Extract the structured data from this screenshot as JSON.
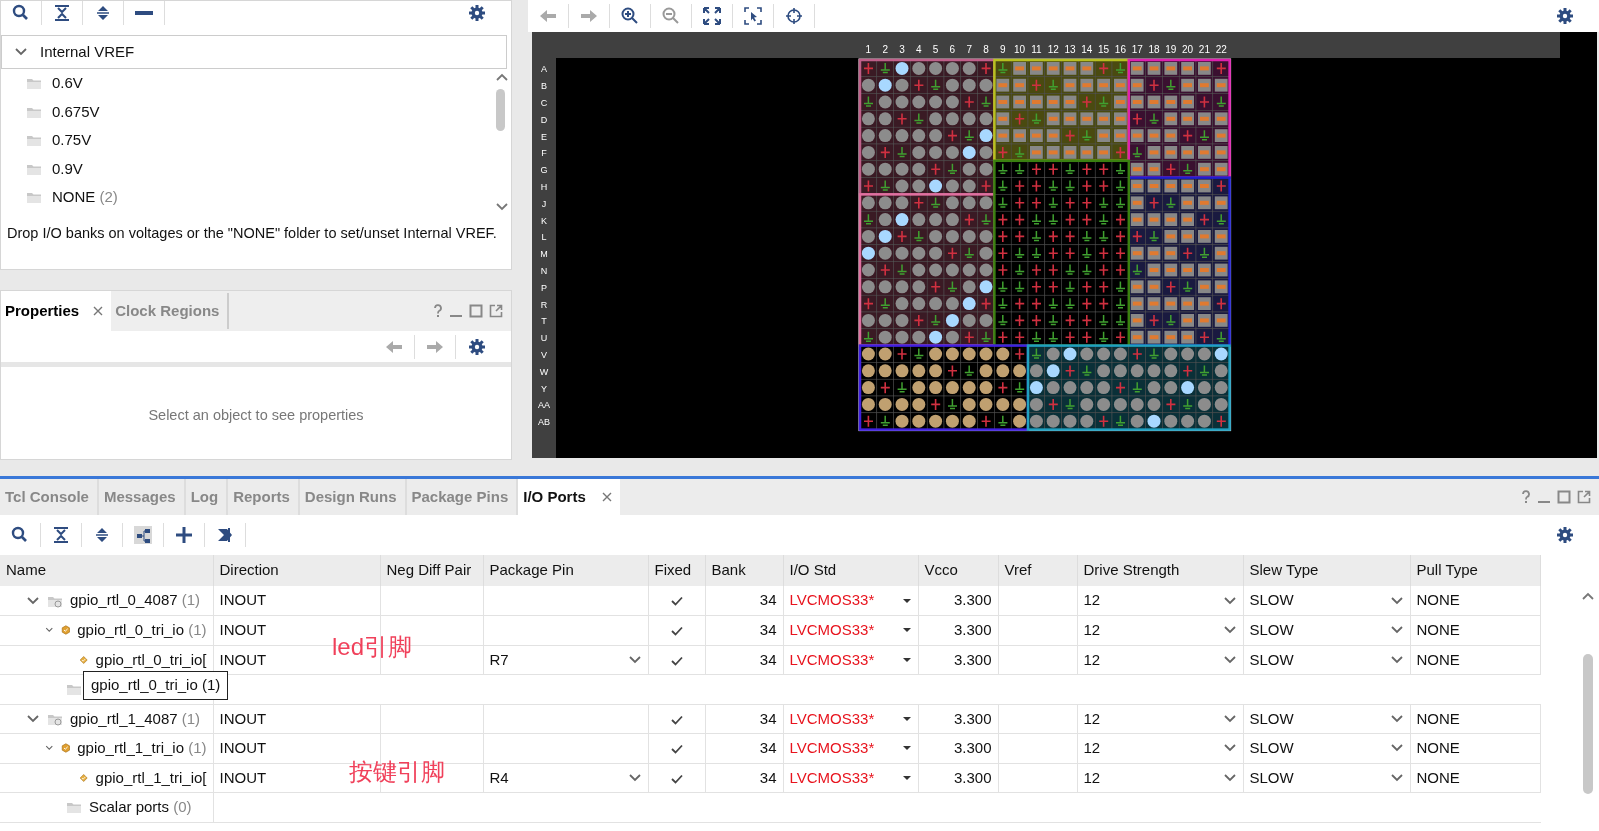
{
  "vref_panel": {
    "header": "Internal VREF",
    "expanded": true,
    "items": [
      {
        "label": "0.6V"
      },
      {
        "label": "0.675V"
      },
      {
        "label": "0.75V"
      },
      {
        "label": "0.9V"
      },
      {
        "label": "NONE",
        "count": "(2)"
      }
    ],
    "hint": "Drop I/O banks on voltages or the \"NONE\" folder to set/unset Internal VREF."
  },
  "properties_panel": {
    "tabs": [
      {
        "label": "Properties",
        "selected": true,
        "closable": true
      },
      {
        "label": "Clock Regions",
        "selected": false,
        "closable": false
      }
    ],
    "empty_message": "Select an object to see properties"
  },
  "package_view": {
    "column_labels": [
      "1",
      "2",
      "3",
      "4",
      "5",
      "6",
      "7",
      "8",
      "9",
      "10",
      "11",
      "12",
      "13",
      "14",
      "15",
      "16",
      "17",
      "18",
      "19",
      "20",
      "21",
      "22"
    ],
    "row_labels": [
      "A",
      "B",
      "C",
      "D",
      "E",
      "F",
      "G",
      "H",
      "J",
      "K",
      "L",
      "M",
      "N",
      "P",
      "R",
      "T",
      "U",
      "V",
      "W",
      "Y",
      "AA",
      "AB"
    ]
  },
  "io_ports_panel": {
    "tabs": [
      {
        "label": "Tcl Console",
        "selected": false,
        "closable": false
      },
      {
        "label": "Messages",
        "selected": false,
        "closable": false
      },
      {
        "label": "Log",
        "selected": false,
        "closable": false
      },
      {
        "label": "Reports",
        "selected": false,
        "closable": false
      },
      {
        "label": "Design Runs",
        "selected": false,
        "closable": false
      },
      {
        "label": "Package Pins",
        "selected": false,
        "closable": false
      },
      {
        "label": "I/O Ports",
        "selected": true,
        "closable": true
      }
    ],
    "columns": [
      "Name",
      "Direction",
      "Neg Diff Pair",
      "Package Pin",
      "Fixed",
      "Bank",
      "I/O Std",
      "Vcco",
      "Vref",
      "Drive Strength",
      "Slew Type",
      "Pull Type"
    ],
    "rows": [
      {
        "kind": "group",
        "name": "gpio_rtl_0_4087",
        "count": "(1)",
        "expanded": true,
        "direction": "INOUT",
        "fixed": true,
        "bank": "34",
        "io_std": "LVCMOS33*",
        "vcco": "3.300",
        "drive_strength": "12",
        "slew_type": "SLOW",
        "pull_type": "NONE",
        "children": [
          {
            "kind": "bus",
            "name": "gpio_rtl_0_tri_io",
            "count": "(1)",
            "expanded": true,
            "direction": "INOUT",
            "fixed": true,
            "bank": "34",
            "io_std": "LVCMOS33*",
            "vcco": "3.300",
            "drive_strength": "12",
            "slew_type": "SLOW",
            "pull_type": "NONE",
            "children": [
              {
                "kind": "port",
                "name": "gpio_rtl_0_tri_io[",
                "direction": "INOUT",
                "package_pin": "R7",
                "fixed": true,
                "bank": "34",
                "io_std": "LVCMOS33*",
                "vcco": "3.300",
                "drive_strength": "12",
                "slew_type": "SLOW",
                "pull_type": "NONE"
              }
            ]
          },
          {
            "kind": "covered"
          }
        ]
      },
      {
        "kind": "group",
        "name": "gpio_rtl_1_4087",
        "count": "(1)",
        "expanded": true,
        "direction": "INOUT",
        "fixed": true,
        "bank": "34",
        "io_std": "LVCMOS33*",
        "vcco": "3.300",
        "drive_strength": "12",
        "slew_type": "SLOW",
        "pull_type": "NONE",
        "children": [
          {
            "kind": "bus",
            "name": "gpio_rtl_1_tri_io",
            "count": "(1)",
            "expanded": true,
            "direction": "INOUT",
            "fixed": true,
            "bank": "34",
            "io_std": "LVCMOS33*",
            "vcco": "3.300",
            "drive_strength": "12",
            "slew_type": "SLOW",
            "pull_type": "NONE",
            "children": [
              {
                "kind": "port",
                "name": "gpio_rtl_1_tri_io[",
                "direction": "INOUT",
                "package_pin": "R4",
                "fixed": true,
                "bank": "34",
                "io_std": "LVCMOS33*",
                "vcco": "3.300",
                "drive_strength": "12",
                "slew_type": "SLOW",
                "pull_type": "NONE"
              }
            ]
          },
          {
            "kind": "folder",
            "name": "Scalar ports",
            "count": "(0)"
          }
        ]
      }
    ],
    "tooltip": "gpio_rtl_0_tri_io (1)",
    "annotations": [
      {
        "text": "led引脚"
      },
      {
        "text": "按键引脚"
      }
    ]
  }
}
